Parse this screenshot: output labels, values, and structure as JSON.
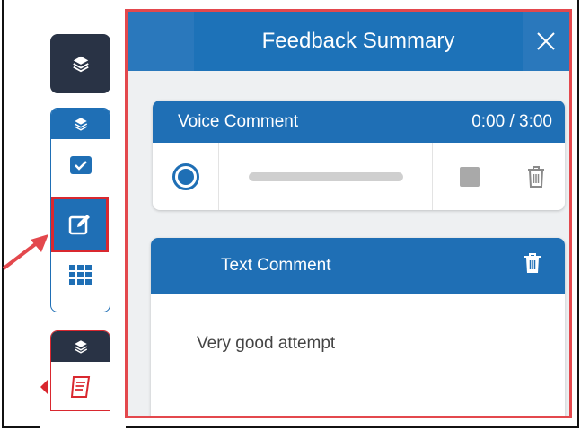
{
  "panel": {
    "title": "Feedback Summary",
    "close_icon": "close-icon"
  },
  "voice_comment": {
    "title": "Voice Comment",
    "time": "0:00 / 3:00",
    "progress": 0
  },
  "text_comment": {
    "title": "Text Comment",
    "body": "Very good attempt"
  },
  "colors": {
    "accent": "#1f6fb5",
    "dark": "#293345",
    "highlight": "#d9282f"
  }
}
